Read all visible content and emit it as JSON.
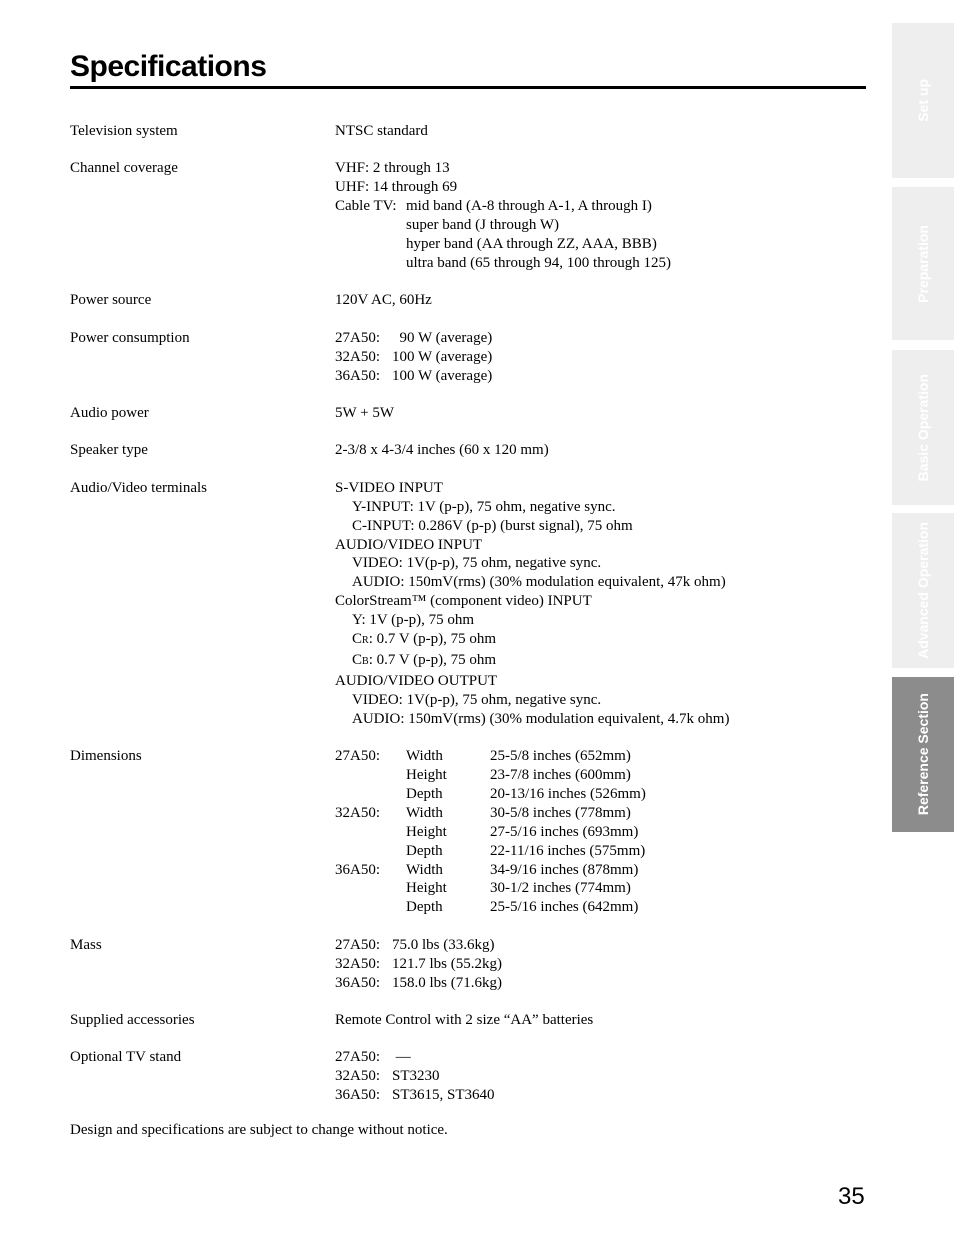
{
  "header": {
    "title": "Specifications"
  },
  "sidebar": {
    "tabs": [
      {
        "label": "Set up",
        "active": false
      },
      {
        "label": "Preparation",
        "active": false
      },
      {
        "label": "Basic Operation",
        "active": false
      },
      {
        "label": "Advanced Operation",
        "active": false
      },
      {
        "label": "Reference Section",
        "active": true
      }
    ],
    "colors": {
      "inactive": "#eeeeee",
      "active": "#8c8c8c",
      "text": "#ffffff"
    }
  },
  "specs": {
    "television_system": {
      "label": "Television system",
      "value": "NTSC standard"
    },
    "channel_coverage": {
      "label": "Channel coverage",
      "vhf": "VHF: 2 through 13",
      "uhf": "UHF: 14 through 69",
      "cable_tag": "Cable TV:",
      "cable": [
        "mid band (A-8 through A-1, A through I)",
        "super band (J through W)",
        "hyper band (AA through ZZ, AAA, BBB)",
        "ultra band (65 through 94, 100 through 125)"
      ]
    },
    "power_source": {
      "label": "Power source",
      "value": "120V AC, 60Hz"
    },
    "power_consumption": {
      "label": "Power consumption",
      "items": [
        {
          "model": "27A50:",
          "value": "  90 W (average)"
        },
        {
          "model": "32A50:",
          "value": "100 W (average)"
        },
        {
          "model": "36A50:",
          "value": "100 W (average)"
        }
      ]
    },
    "audio_power": {
      "label": "Audio power",
      "value": "5W + 5W"
    },
    "speaker_type": {
      "label": "Speaker type",
      "value": "2-3/8 x 4-3/4 inches (60 x 120 mm)"
    },
    "av_terminals": {
      "label": "Audio/Video terminals",
      "svideo": "S-VIDEO INPUT",
      "svideo_y": "Y-INPUT: 1V (p-p), 75 ohm, negative sync.",
      "svideo_c": "C-INPUT: 0.286V (p-p) (burst signal), 75 ohm",
      "av_in": "AUDIO/VIDEO INPUT",
      "av_in_video": "VIDEO: 1V(p-p), 75 ohm, negative sync.",
      "av_in_audio": "AUDIO: 150mV(rms) (30% modulation equivalent, 47k ohm)",
      "colorstream": "ColorStream™ (component video) INPUT",
      "cs_y": "Y: 1V (p-p), 75 ohm",
      "cs_cr_c": "C",
      "cs_cr_sub": "R",
      "cs_cr_rest": ": 0.7 V (p-p), 75 ohm",
      "cs_cb_c": "C",
      "cs_cb_sub": "B",
      "cs_cb_rest": ": 0.7 V (p-p), 75 ohm",
      "av_out": "AUDIO/VIDEO OUTPUT",
      "av_out_video": "VIDEO: 1V(p-p), 75 ohm, negative sync.",
      "av_out_audio": "AUDIO: 150mV(rms) (30% modulation equivalent, 4.7k ohm)"
    },
    "dimensions": {
      "label": "Dimensions",
      "rows": [
        {
          "model": "27A50:",
          "key": "Width",
          "value": "25-5/8 inches (652mm)"
        },
        {
          "model": "",
          "key": "Height",
          "value": "23-7/8 inches (600mm)"
        },
        {
          "model": "",
          "key": "Depth",
          "value": "20-13/16 inches (526mm)"
        },
        {
          "model": "32A50:",
          "key": "Width",
          "value": "30-5/8 inches (778mm)"
        },
        {
          "model": "",
          "key": "Height",
          "value": "27-5/16 inches (693mm)"
        },
        {
          "model": "",
          "key": "Depth",
          "value": "22-11/16 inches (575mm)"
        },
        {
          "model": "36A50:",
          "key": "Width",
          "value": "34-9/16 inches (878mm)"
        },
        {
          "model": "",
          "key": "Height",
          "value": "30-1/2 inches (774mm)"
        },
        {
          "model": "",
          "key": "Depth",
          "value": "25-5/16 inches (642mm)"
        }
      ]
    },
    "mass": {
      "label": "Mass",
      "items": [
        {
          "model": "27A50:",
          "value": "75.0 lbs (33.6kg)"
        },
        {
          "model": "32A50:",
          "value": "121.7 lbs (55.2kg)"
        },
        {
          "model": "36A50:",
          "value": "158.0 lbs (71.6kg)"
        }
      ]
    },
    "supplied_accessories": {
      "label": "Supplied accessories",
      "value": "Remote Control with 2 size “AA” batteries"
    },
    "optional_stand": {
      "label": "Optional TV stand",
      "items": [
        {
          "model": "27A50:",
          "value": " —"
        },
        {
          "model": "32A50:",
          "value": "ST3230"
        },
        {
          "model": "36A50:",
          "value": "ST3615, ST3640"
        }
      ]
    }
  },
  "footer": {
    "notice": "Design and specifications are subject to change without notice.",
    "page_number": "35"
  }
}
